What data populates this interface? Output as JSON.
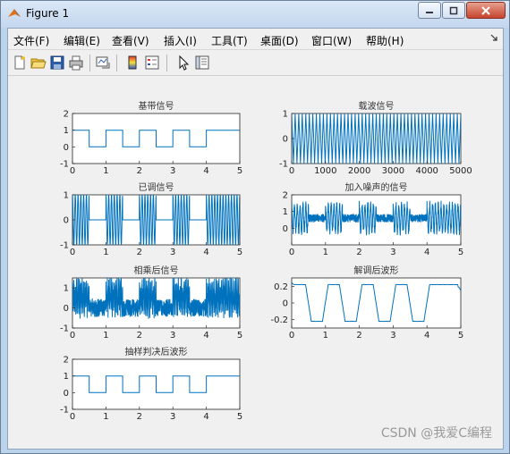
{
  "window": {
    "title": "Figure 1",
    "controls": [
      "minimize",
      "maximize",
      "close"
    ]
  },
  "menu": {
    "items": [
      {
        "label": "文件(F)"
      },
      {
        "label": "编辑(E)"
      },
      {
        "label": "查看(V)"
      },
      {
        "label": "插入(I)"
      },
      {
        "label": "工具(T)"
      },
      {
        "label": "桌面(D)"
      },
      {
        "label": "窗口(W)"
      },
      {
        "label": "帮助(H)"
      }
    ]
  },
  "toolbar": {
    "icons": [
      "new-figure-icon",
      "open-icon",
      "save-icon",
      "print-icon",
      "link-plot-icon",
      "insert-colorbar-icon",
      "insert-legend-icon",
      "edit-plot-arrow-icon",
      "property-inspector-icon"
    ]
  },
  "chart_data": [
    {
      "type": "line",
      "title": "基带信号",
      "xlim": [
        0,
        5
      ],
      "ylim": [
        -1,
        2
      ],
      "xticks": [
        "0",
        "1",
        "2",
        "3",
        "4",
        "5"
      ],
      "yticks": [
        "-1",
        "0",
        "1",
        "2"
      ],
      "series": [
        {
          "x": [
            0,
            0.5,
            0.5,
            1,
            1,
            1.5,
            1.5,
            2,
            2,
            2.5,
            2.5,
            3,
            3,
            3.5,
            3.5,
            4,
            4,
            5
          ],
          "y": [
            1,
            1,
            0,
            0,
            1,
            1,
            0,
            0,
            1,
            1,
            0,
            0,
            1,
            1,
            0,
            0,
            1,
            1
          ]
        }
      ]
    },
    {
      "type": "line",
      "title": "载波信号",
      "xlim": [
        0,
        5000
      ],
      "ylim": [
        -1,
        1
      ],
      "xticks": [
        "0",
        "1000",
        "2000",
        "3000",
        "4000",
        "5000"
      ],
      "yticks": [
        "-1",
        "0",
        "1"
      ],
      "series": [
        {
          "description_kind": "carrier",
          "cycles": 48,
          "amplitude": 1
        }
      ]
    },
    {
      "type": "line",
      "title": "已调信号",
      "xlim": [
        0,
        5
      ],
      "ylim": [
        -1,
        1
      ],
      "xticks": [
        "0",
        "1",
        "2",
        "3",
        "4",
        "5"
      ],
      "yticks": [
        "-1",
        "0",
        "1"
      ],
      "series": [
        {
          "on_intervals": [
            [
              0,
              0.5
            ],
            [
              1,
              1.5
            ],
            [
              2,
              2.5
            ],
            [
              3,
              3.5
            ],
            [
              4,
              5
            ]
          ],
          "amplitude": 1
        }
      ]
    },
    {
      "type": "line",
      "title": "加入噪声的信号",
      "xlim": [
        0,
        5
      ],
      "ylim": [
        -1,
        2
      ],
      "xticks": [
        "0",
        "1",
        "2",
        "3",
        "4",
        "5"
      ],
      "yticks": [
        "0",
        "1",
        "2"
      ],
      "series": [
        {
          "on_intervals": [
            [
              0,
              0.5
            ],
            [
              1,
              1.5
            ],
            [
              2,
              2.5
            ],
            [
              3,
              3.5
            ],
            [
              4,
              5
            ]
          ],
          "amplitude": 1
        }
      ]
    },
    {
      "type": "line",
      "title": "相乘后信号",
      "xlim": [
        0,
        5
      ],
      "ylim": [
        -1,
        1.5
      ],
      "xticks": [
        "0",
        "1",
        "2",
        "3",
        "4",
        "5"
      ],
      "yticks": [
        "-1",
        "0",
        "1"
      ],
      "series": [
        {
          "on_intervals": [
            [
              0,
              0.5
            ],
            [
              1,
              1.5
            ],
            [
              2,
              2.5
            ],
            [
              3,
              3.5
            ],
            [
              4,
              5
            ]
          ],
          "amplitude": 1.3
        }
      ]
    },
    {
      "type": "line",
      "title": "解调后波形",
      "xlim": [
        0,
        5
      ],
      "ylim": [
        -0.3,
        0.3
      ],
      "xticks": [
        "0",
        "1",
        "2",
        "3",
        "4",
        "5"
      ],
      "yticks": [
        "-0.2",
        "0",
        "0.2"
      ],
      "series": [
        {
          "high_intervals": [
            [
              0,
              0.5
            ],
            [
              1,
              1.5
            ],
            [
              2,
              2.5
            ],
            [
              3,
              3.5
            ],
            [
              4,
              5
            ]
          ],
          "high": 0.22,
          "low": -0.22
        }
      ]
    },
    {
      "type": "line",
      "title": "抽样判决后波形",
      "xlim": [
        0,
        5
      ],
      "ylim": [
        -1,
        2
      ],
      "xticks": [
        "0",
        "1",
        "2",
        "3",
        "4",
        "5"
      ],
      "yticks": [
        "-1",
        "0",
        "1",
        "2"
      ],
      "series": [
        {
          "x": [
            0,
            0.5,
            0.5,
            1,
            1,
            1.5,
            1.5,
            2,
            2,
            2.5,
            2.5,
            3,
            3,
            3.5,
            3.5,
            4,
            4,
            5
          ],
          "y": [
            1,
            1,
            0,
            0,
            1,
            1,
            0,
            0,
            1,
            1,
            0,
            0,
            1,
            1,
            0,
            0,
            1,
            1
          ]
        }
      ]
    }
  ],
  "colors": {
    "line": "#0072bd",
    "axes_bg": "#ffffff",
    "figure_bg": "#f0f0f0"
  },
  "watermark": "CSDN @我爱C编程"
}
